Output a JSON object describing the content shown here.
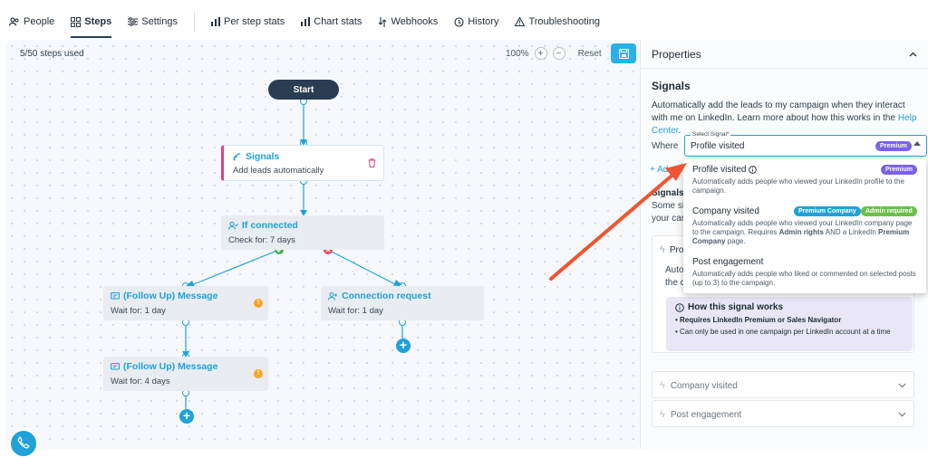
{
  "nav": {
    "tabs": [
      {
        "label": "People",
        "icon": "people-icon"
      },
      {
        "label": "Steps",
        "icon": "steps-icon"
      },
      {
        "label": "Settings",
        "icon": "settings-icon"
      },
      {
        "label": "Per step stats",
        "icon": "bar-chart-icon"
      },
      {
        "label": "Chart stats",
        "icon": "bar-chart-icon"
      },
      {
        "label": "Webhooks",
        "icon": "webhooks-icon"
      },
      {
        "label": "History",
        "icon": "history-icon"
      },
      {
        "label": "Troubleshooting",
        "icon": "warning-icon"
      }
    ]
  },
  "canvas": {
    "steps_used": "5/50 steps used",
    "zoom": "100%",
    "zoom_in": "+",
    "zoom_out": "−",
    "reset": "Reset"
  },
  "flow": {
    "start": "Start",
    "signals": {
      "title": "Signals",
      "sub": "Add leads automatically"
    },
    "if_connected": {
      "title": "If connected",
      "sub": "Check for: 7 days"
    },
    "message1": {
      "title": "(Follow Up) Message",
      "sub": "Wait for: 1 day"
    },
    "connection": {
      "title": "Connection request",
      "sub": "Wait for: 1 day"
    },
    "message2": {
      "title": "(Follow Up) Message",
      "sub": "Wait for: 4 days"
    },
    "warn_glyph": "!",
    "plus_glyph": "+"
  },
  "properties": {
    "title": "Properties",
    "heading": "Signals",
    "desc_text": "Automatically add the leads to my campaign when they interact with me on LinkedIn. Learn more about how this works in the ",
    "desc_link": "Help Center",
    "desc_end": ".",
    "where": "Where",
    "select_label": "Select Signal*",
    "select_value": "Profile visited",
    "select_badge": "Premium",
    "behind_add": "+ Ad",
    "behind_signals": "Signals",
    "behind_some": "Some sig",
    "behind_your": "your can",
    "behind_pro": "Pro",
    "behind_auto": "Auto",
    "behind_the": "the c",
    "accordion": {
      "company": "Company visited",
      "post": "Post engagement"
    },
    "how": {
      "title": "How this signal works",
      "line1": "• Requires LinkedIn Premium or Sales Navigator",
      "line2": "• Can only be used in one campaign per LinkedIn account at a time"
    }
  },
  "dropdown": {
    "options": [
      {
        "title": "Profile visited",
        "desc": "Automatically adds people who viewed your LinkedIn profile to the campaign.",
        "badge": "Premium"
      },
      {
        "title": "Company visited",
        "desc_a": "Automatically adds people who viewed your LinkedIn company page to the campaign. Requires ",
        "desc_b": "Admin rights",
        "desc_c": " AND a LinkedIn ",
        "desc_d": "Premium Company",
        "desc_e": " page.",
        "badge1": "Premium Company",
        "badge2": "Admin required"
      },
      {
        "title": "Post engagement",
        "desc": "Automatically adds people who liked or commented on selected posts (up to 3) to the campaign."
      }
    ]
  },
  "colors": {
    "accent": "#1fa2d8",
    "premium": "#7b61e8",
    "admin": "#6cc04a",
    "arrow": "#ee5533",
    "warning": "#f5a623"
  }
}
